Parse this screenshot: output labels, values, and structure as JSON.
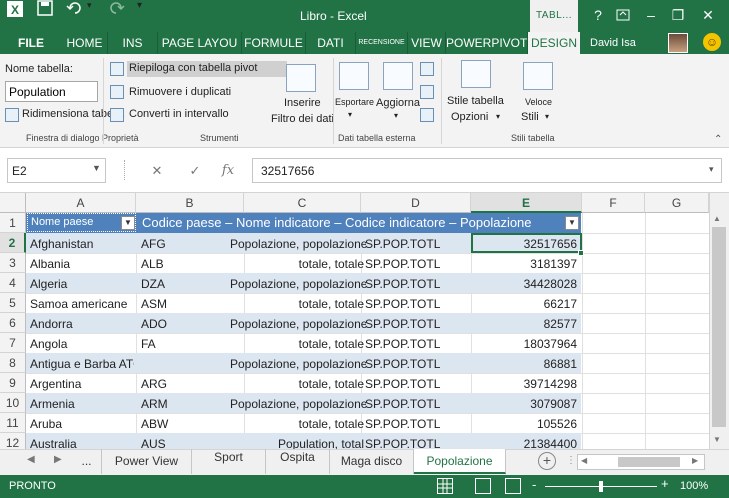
{
  "window": {
    "title": "Libro - Excel",
    "context_tab_group": "TABL...",
    "help": "?",
    "minimize": "–",
    "restore": "❐",
    "close": "✕"
  },
  "ribbon_tabs": [
    "FILE",
    "HOME",
    "INS",
    "PAGE LAYOU",
    "FORMULE",
    "DATI",
    "RECENSIONE",
    "VIEW",
    "POWERPIVOT",
    "DESIGN"
  ],
  "user": {
    "name": "David Isa"
  },
  "ribbon": {
    "proprieta": {
      "nome_tabella_label": "Nome tabella:",
      "nome_tabella_value": "Population",
      "ridimensiona": "Ridimensiona tabella",
      "group_label": "Finestra di dialogo Proprietà"
    },
    "strumenti": {
      "riepiloga": "Riepiloga con tabella pivot",
      "rimuovi": "Rimuovere i duplicati",
      "converti": "Converti in intervallo",
      "inserire_1": "Inserire",
      "inserire_2": "Filtro dei dati",
      "group_label": "Strumenti"
    },
    "dati_esterna": {
      "esporta": "Esportare",
      "aggiorna": "Aggiorna",
      "group_label": "Dati tabella esterna"
    },
    "stili": {
      "opzioni_1": "Stile tabella",
      "opzioni_2": "Opzioni",
      "veloci_1": "Veloce",
      "veloci_2": "Stili",
      "group_label": "Stili tabella"
    }
  },
  "formula_bar": {
    "name_box": "E2",
    "cancel": "✕",
    "enter": "✓",
    "fx": "fx",
    "value": "32517656"
  },
  "columns": [
    "A",
    "B",
    "C",
    "D",
    "E",
    "F",
    "G"
  ],
  "table_header": {
    "a": "Nome paese",
    "rest": "Codice paese – Nome indicatore – Codice indicatore – Popolazione"
  },
  "rows": [
    {
      "num": "1"
    },
    {
      "num": "2",
      "a": "Afghanistan",
      "b": "AFG",
      "c": "Popolazione, popolazione",
      "d": "SP.POP.TOTL",
      "e": "32517656"
    },
    {
      "num": "3",
      "a": "Albania",
      "b": "ALB",
      "c": "totale, totale",
      "d": "SP.POP.TOTL",
      "e": "3181397"
    },
    {
      "num": "4",
      "a": "Algeria",
      "b": "DZA",
      "c": "Popolazione, popolazione",
      "d": "SP.POP.TOTL",
      "e": "34428028"
    },
    {
      "num": "5",
      "a": "Samoa americane",
      "b": "ASM",
      "c": "totale, totale",
      "d": "SP.POP.TOTL",
      "e": "66217"
    },
    {
      "num": "6",
      "a": "Andorra",
      "b": "ADO",
      "c": "Popolazione, popolazione",
      "d": "SP.POP.TOTL",
      "e": "82577"
    },
    {
      "num": "7",
      "a": "Angola",
      "b": "FA",
      "c": "totale, totale",
      "d": "SP.POP.TOTL",
      "e": "18037964"
    },
    {
      "num": "8",
      "a": "Antigua e Barba ATG",
      "b": "",
      "c": "Popolazione, popolazione",
      "d": "SP.POP.TOTL",
      "e": "86881"
    },
    {
      "num": "9",
      "a": "Argentina",
      "b": "ARG",
      "c": "totale, totale",
      "d": "SP.POP.TOTL",
      "e": "39714298"
    },
    {
      "num": "10",
      "a": "Armenia",
      "b": "ARM",
      "c": "Popolazione, popolazione",
      "d": "SP.POP.TOTL",
      "e": "3079087"
    },
    {
      "num": "11",
      "a": "Aruba",
      "b": "ABW",
      "c": "totale, totale",
      "d": "SP.POP.TOTL",
      "e": "105526"
    },
    {
      "num": "12",
      "a": "Australia",
      "b": "AUS",
      "c": "Population, total",
      "d": "SP.POP.TOTL",
      "e": "21384400"
    }
  ],
  "sheet_tabs": {
    "ellipsis": "...",
    "tabs": [
      "Power View",
      "Sport",
      "Ospita",
      "Maga disco",
      "Popolazione"
    ],
    "add": "+"
  },
  "status": {
    "ready": "PRONTO",
    "zoom_minus": "-",
    "zoom_plus": "+",
    "zoom": "100%",
    "zoom_level": 1.0
  },
  "colors": {
    "excel_green": "#217346",
    "table_header": "#4f81bd",
    "band_light": "#dce6f1"
  }
}
